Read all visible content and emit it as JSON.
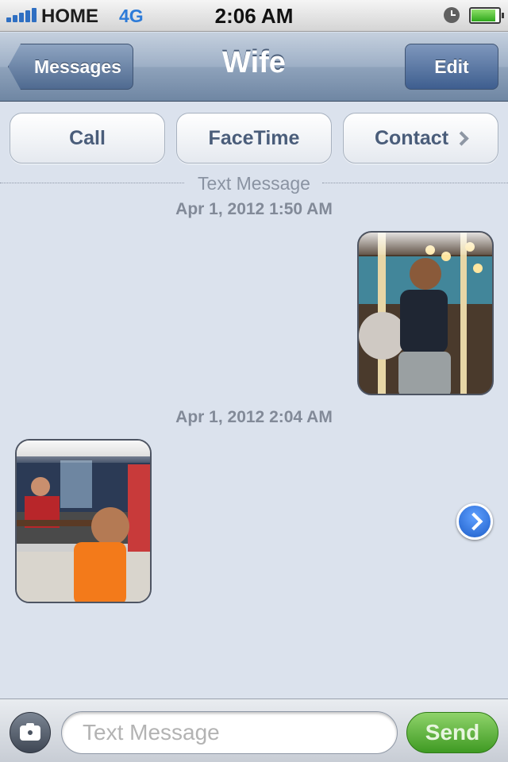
{
  "status_bar": {
    "carrier": "HOME",
    "network": "4G",
    "time": "2:06 AM",
    "icons": [
      "signal-icon",
      "alarm-icon",
      "battery-icon"
    ]
  },
  "nav": {
    "back_label": "Messages",
    "title": "Wife",
    "edit_label": "Edit"
  },
  "actions": {
    "call": "Call",
    "facetime": "FaceTime",
    "contact": "Contact"
  },
  "thread": {
    "separator_label": "Text Message",
    "messages": [
      {
        "timestamp": "Apr 1, 2012 1:50 AM",
        "direction": "sent",
        "type": "photo"
      },
      {
        "timestamp": "Apr 1, 2012 2:04 AM",
        "direction": "received",
        "type": "photo"
      }
    ]
  },
  "composer": {
    "placeholder": "Text Message",
    "send_label": "Send"
  },
  "colors": {
    "background": "#dbe2ed",
    "nav_bar": "#8ea2bb",
    "send_button": "#3f9a23",
    "detail_button": "#1e5ec9"
  }
}
